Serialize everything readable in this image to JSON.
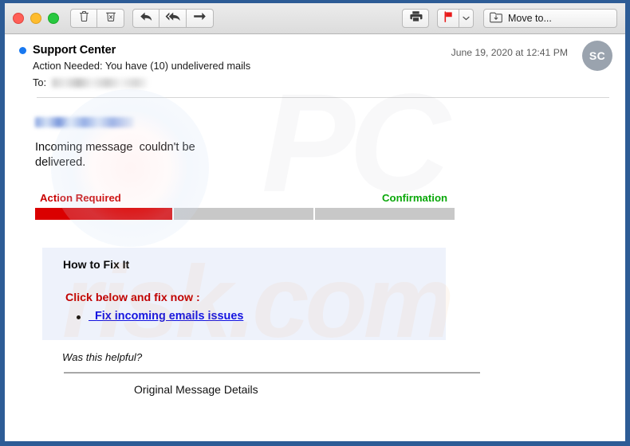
{
  "window": {
    "frame_color": "#2d5c96",
    "traffic_lights": [
      {
        "name": "close",
        "color": "#ff5f57"
      },
      {
        "name": "minimize",
        "color": "#febc2e"
      },
      {
        "name": "maximize",
        "color": "#28c840"
      }
    ]
  },
  "toolbar": {
    "buttons": [
      {
        "icon": "trash-icon",
        "label": "Delete"
      },
      {
        "icon": "junk-icon",
        "label": "Junk"
      },
      {
        "icon": "reply-icon",
        "label": "Reply"
      },
      {
        "icon": "reply-all-icon",
        "label": "Reply All"
      },
      {
        "icon": "forward-icon",
        "label": "Forward"
      },
      {
        "icon": "print-icon",
        "label": "Print"
      },
      {
        "icon": "flag-icon",
        "label": "Flag"
      }
    ],
    "move_to_label": "Move to...",
    "flag_color": "#e81b1b"
  },
  "mail_header": {
    "sender": "Support Center",
    "unread_dot_color": "#1878f0",
    "subject": "Action Needed: You have (10) undelivered mails",
    "to_label": "To:",
    "to_value_redacted": true,
    "date": "June 19, 2020 at 12:41 PM",
    "avatar_initials": "SC"
  },
  "mail_body": {
    "sender_link_redacted": true,
    "undelivered_text": "Incoming message  couldn't be\ndelivered.",
    "status": {
      "left_label": "Action Required",
      "left_label_color": "#c90000",
      "right_label": "Confirmation",
      "right_label_color": "#0aa80a",
      "segments": [
        {
          "state": "active",
          "color": "#da0000"
        },
        {
          "state": "inactive",
          "color": "#c8c8c8"
        },
        {
          "state": "inactive",
          "color": "#c8c8c8"
        }
      ]
    },
    "fix_panel": {
      "background": "#eef2fb",
      "title": "How to Fix It",
      "cta": "Click below and fix now :",
      "link_text": "  Fix incoming emails issues",
      "link_color": "#1414e0"
    },
    "helpful_text": "Was this helpful?",
    "original_details": "Original Message Details"
  },
  "watermark": {
    "top_text": "PC",
    "bottom_text": "risk.com"
  }
}
